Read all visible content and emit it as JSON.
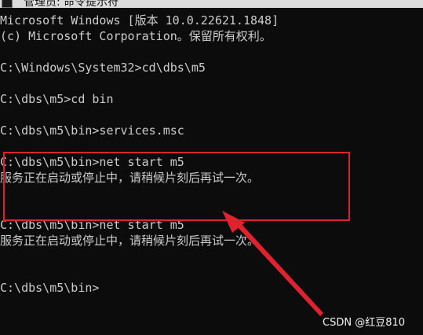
{
  "window": {
    "title": "管理员: 命令提示符"
  },
  "console": {
    "lines": [
      "Microsoft Windows [版本 10.0.22621.1848]",
      "(c) Microsoft Corporation。保留所有权利。",
      "",
      "C:\\Windows\\System32>cd\\dbs\\m5",
      "",
      "C:\\dbs\\m5>cd bin",
      "",
      "C:\\dbs\\m5\\bin>services.msc",
      "",
      "C:\\dbs\\m5\\bin>net start m5",
      "服务正在启动或停止中，请稍候片刻后再试一次。",
      "",
      "",
      "C:\\dbs\\m5\\bin>net start m5",
      "服务正在启动或停止中，请稍候片刻后再试一次。",
      "",
      "",
      "C:\\dbs\\m5\\bin>"
    ]
  },
  "annotation": {
    "color": "#e0222e"
  },
  "watermark": {
    "text": "CSDN @红豆810"
  }
}
